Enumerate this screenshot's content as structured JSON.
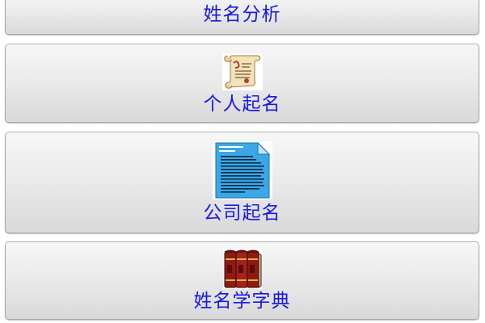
{
  "menu": {
    "items": [
      {
        "label": "姓名分析",
        "icon": "green-icon-partial"
      },
      {
        "label": "个人起名",
        "icon": "scroll-icon"
      },
      {
        "label": "公司起名",
        "icon": "document-icon"
      },
      {
        "label": "姓名学字典",
        "icon": "books-icon"
      }
    ]
  },
  "colors": {
    "label": "#1a1ae0",
    "button_top": "#f7f7f7",
    "button_bottom": "#d9d9d9",
    "button_border": "#a9a9a9"
  }
}
